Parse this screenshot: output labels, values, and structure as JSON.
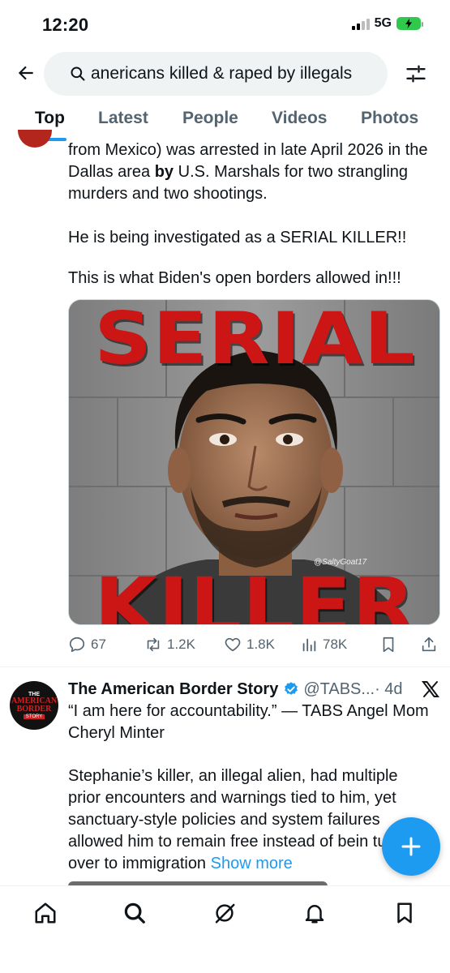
{
  "status_bar": {
    "time": "12:20",
    "network": "5G",
    "battery_icon": "battery-charging-icon"
  },
  "search": {
    "query": "anericans killed & raped by illegals",
    "back_icon": "back-arrow-icon",
    "search_icon": "search-icon",
    "filter_icon": "filter-sliders-icon"
  },
  "tabs": [
    {
      "label": "Top",
      "active": true
    },
    {
      "label": "Latest",
      "active": false
    },
    {
      "label": "People",
      "active": false
    },
    {
      "label": "Videos",
      "active": false
    },
    {
      "label": "Photos",
      "active": false
    }
  ],
  "tweet1": {
    "text_line1_pre": "from Mexico) was arrested in late April 2026 in the Dallas area ",
    "text_line1_bold": "by",
    "text_line1_post": " U.S. Marshals for two strangling murders and two shootings.",
    "paragraph2": "He is being investigated as a SERIAL KILLER!!",
    "paragraph3": "This is what Biden's open borders allowed in!!!",
    "media": {
      "top_word": "SERIAL",
      "bottom_word": "KILLER",
      "credit": "@SaltyGoat17"
    },
    "actions": {
      "replies": "67",
      "reposts": "1.2K",
      "likes": "1.8K",
      "views": "78K"
    }
  },
  "tweet2": {
    "avatar": {
      "line1": "THE",
      "line2": "AMERICAN",
      "line3": "BORDER",
      "line4": "STORY"
    },
    "name": "The American Border Story",
    "handle": "@TABS...",
    "time": "· 4d",
    "paragraph1": "“I am here for accountability.” — TABS Angel Mom Cheryl Minter",
    "paragraph2": "Stephanie’s killer, an illegal alien, had multiple prior encounters and warnings tied to him, yet sanctuary-style policies and system failures allowed him to remain free instead of bein turned over to immigration ",
    "show_more": "Show more"
  },
  "colors": {
    "accent": "#1d9bf0",
    "text": "#0f1419",
    "secondary_text": "#536471",
    "search_bg": "#eff3f4",
    "headline_red": "#cc1616"
  },
  "bottom_nav": [
    {
      "name": "home-icon"
    },
    {
      "name": "search-icon"
    },
    {
      "name": "grok-icon"
    },
    {
      "name": "notifications-bell-icon"
    },
    {
      "name": "bookmark-icon"
    }
  ]
}
